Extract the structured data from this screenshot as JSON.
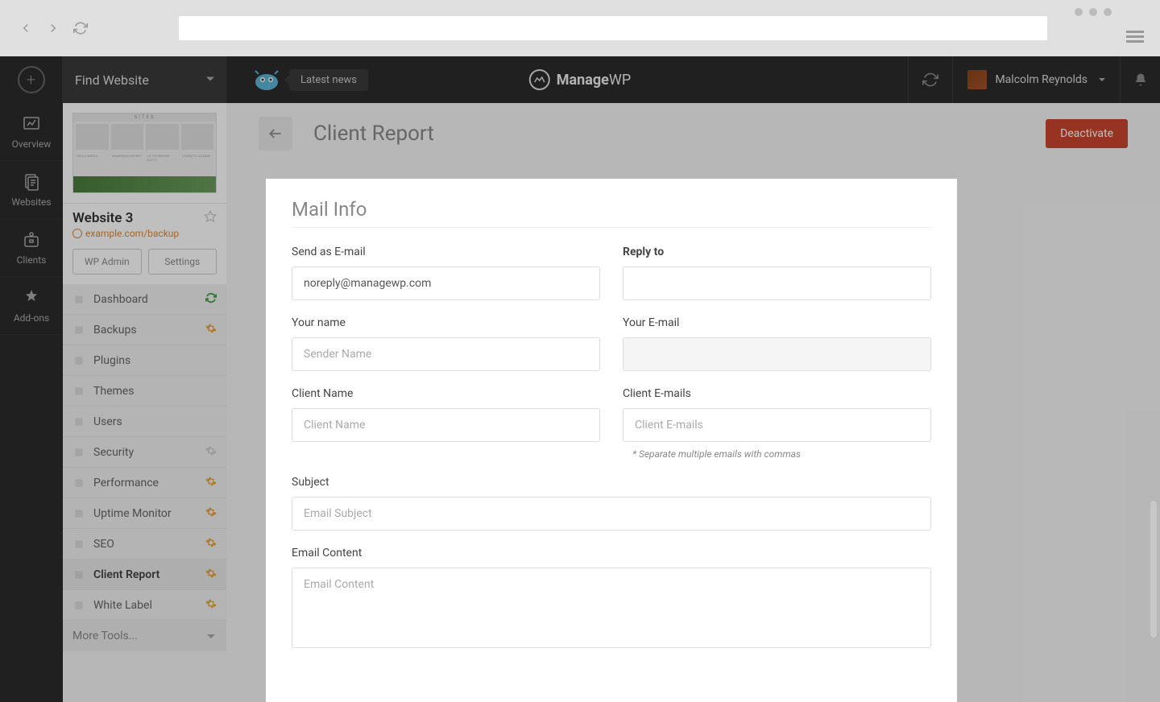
{
  "browser": {},
  "topbar": {
    "find_website": "Find Website",
    "latest_news": "Latest news",
    "brand_bold": "Manage",
    "brand_light": "WP",
    "user_name": "Malcolm Reynolds"
  },
  "leftnav": {
    "overview": "Overview",
    "websites": "Websites",
    "clients": "Clients",
    "addons": "Add-ons"
  },
  "sidebar": {
    "site_title": "Website 3",
    "site_url": "example.com/backup",
    "wp_admin": "WP Admin",
    "settings": "Settings",
    "menu": [
      {
        "label": "Dashboard",
        "indicator": "refresh"
      },
      {
        "label": "Backups",
        "indicator": "gear-active"
      },
      {
        "label": "Plugins",
        "indicator": null
      },
      {
        "label": "Themes",
        "indicator": null
      },
      {
        "label": "Users",
        "indicator": null
      },
      {
        "label": "Security",
        "indicator": "gear"
      },
      {
        "label": "Performance",
        "indicator": "gear-active"
      },
      {
        "label": "Uptime Monitor",
        "indicator": "gear-active"
      },
      {
        "label": "SEO",
        "indicator": "gear-active"
      },
      {
        "label": "Client Report",
        "indicator": "gear-active",
        "active": true
      },
      {
        "label": "White Label",
        "indicator": "gear-active"
      }
    ],
    "more_tools": "More Tools..."
  },
  "page": {
    "title": "Client Report",
    "deactivate": "Deactivate"
  },
  "form": {
    "section_title": "Mail Info",
    "send_as_label": "Send as E-mail",
    "send_as_value": "noreply@managewp.com",
    "reply_to_label": "Reply to",
    "your_name_label": "Your name",
    "your_name_placeholder": "Sender Name",
    "your_email_label": "Your E-mail",
    "client_name_label": "Client Name",
    "client_name_placeholder": "Client Name",
    "client_emails_label": "Client E-mails",
    "client_emails_placeholder": "Client E-mails",
    "client_emails_hint": "* Separate multiple emails with commas",
    "subject_label": "Subject",
    "subject_placeholder": "Email Subject",
    "content_label": "Email Content",
    "content_placeholder": "Email Content"
  }
}
